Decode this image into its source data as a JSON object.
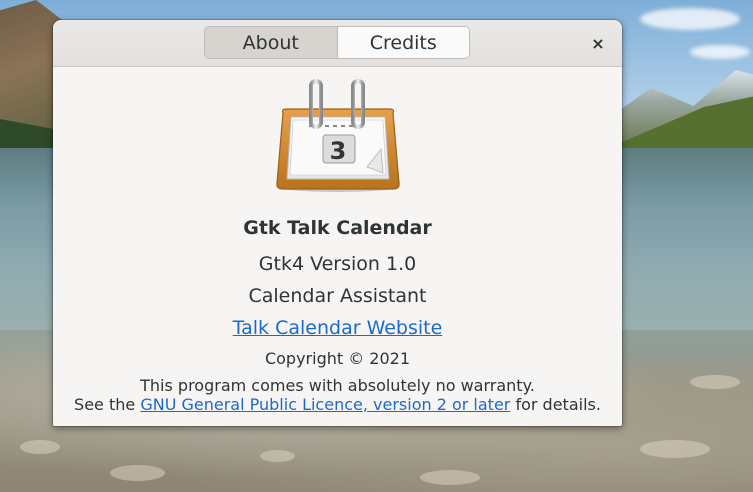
{
  "dialog": {
    "tabs": [
      {
        "label": "About",
        "active": true
      },
      {
        "label": "Credits",
        "active": false
      }
    ],
    "close_icon": "close-icon",
    "close_glyph": "×"
  },
  "about": {
    "app_icon": "calendar-icon",
    "calendar_day": "3",
    "app_name": "Gtk Talk Calendar",
    "version": "Gtk4 Version 1.0",
    "comments": "Calendar Assistant",
    "website_label": "Talk Calendar Website",
    "copyright": "Copyright © 2021",
    "license": {
      "line1": "This program comes with absolutely no warranty.",
      "line2_prefix": "See the ",
      "line2_link": "GNU General Public Licence, version 2 or later",
      "line2_suffix": " for details."
    }
  },
  "colors": {
    "link": "#1b6acb",
    "text": "#2e3436",
    "dialog_bg": "#f6f5f4"
  }
}
